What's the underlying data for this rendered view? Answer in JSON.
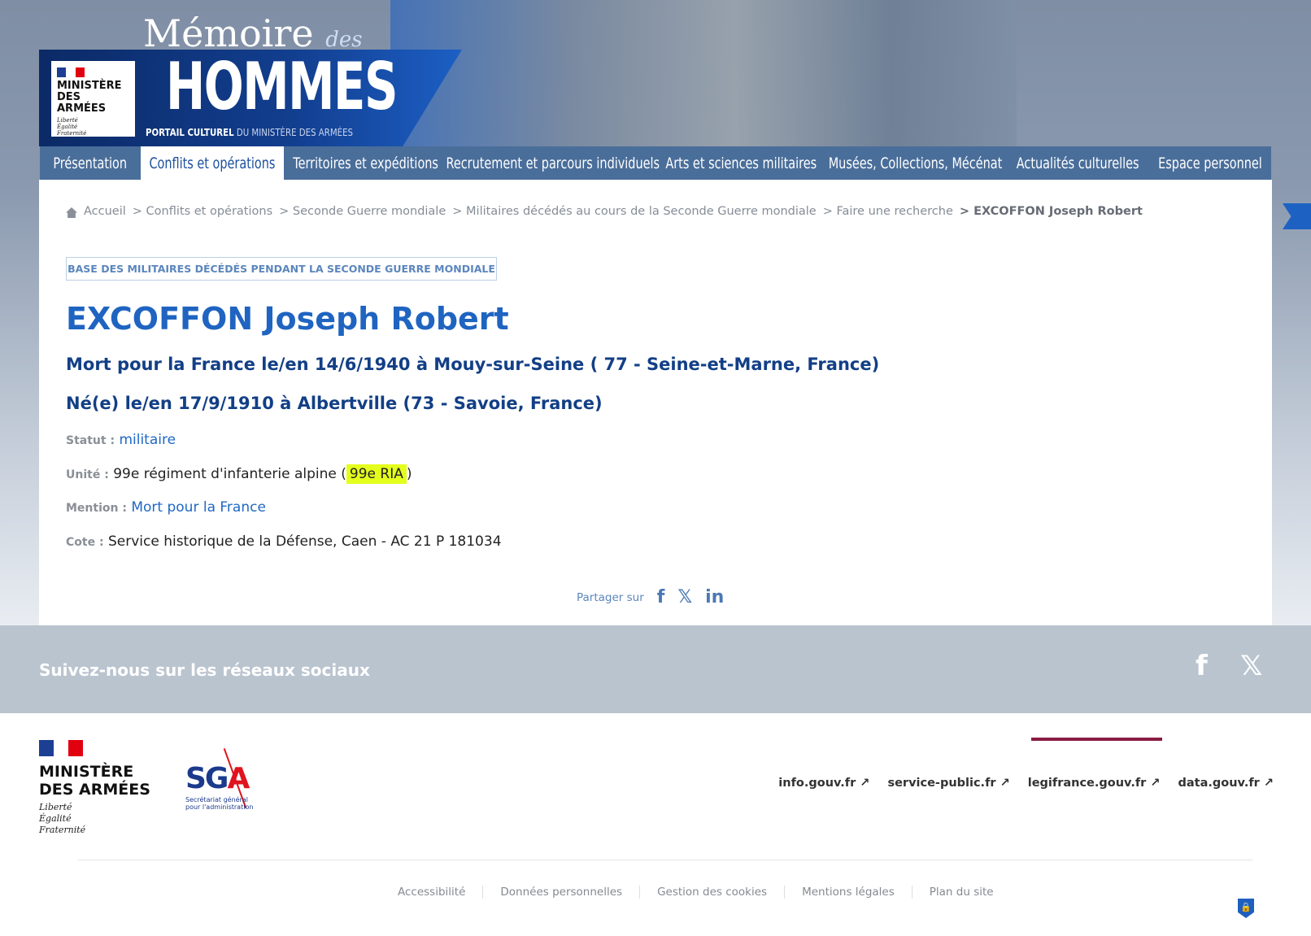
{
  "header": {
    "site_title_1": "Mémoire",
    "site_title_des": "des",
    "site_title_2": "HOMMES",
    "tagline_bold": "PORTAIL CULTUREL",
    "tagline_rest": " DU MINISTÈRE DES ARMÉES",
    "ministry": "MINISTÈRE DES ARMÉES",
    "motto": [
      "Liberté",
      "Égalité",
      "Fraternité"
    ]
  },
  "nav": [
    {
      "label": "Présentation"
    },
    {
      "label": "Conflits et opérations",
      "active": true
    },
    {
      "label": "Territoires et expéditions"
    },
    {
      "label": "Recrutement et parcours individuels"
    },
    {
      "label": "Arts et sciences militaires"
    },
    {
      "label": "Musées, Collections, Mécénat"
    },
    {
      "label": "Actualités culturelles"
    },
    {
      "label": "Espace personnel"
    }
  ],
  "breadcrumb": [
    "Accueil",
    "> Conflits et opérations",
    "> Seconde Guerre mondiale",
    "> Militaires décédés au cours de la Seconde Guerre mondiale",
    "> Faire une recherche",
    "> EXCOFFON Joseph Robert"
  ],
  "record": {
    "badge": "BASE DES MILITAIRES DÉCÉDÉS PENDANT LA SECONDE GUERRE MONDIALE",
    "name": "EXCOFFON Joseph Robert",
    "death": "Mort pour la France le/en 14/6/1940 à Mouy-sur-Seine ( 77 - Seine-et-Marne, France)",
    "birth": "Né(e) le/en 17/9/1910 à Albertville (73 - Savoie, France)",
    "statut_label": "Statut :",
    "statut": "militaire",
    "unite_label": "Unité :",
    "unite": "99e régiment d'infanterie alpine (",
    "unite_abbr": "99e RIA",
    "unite_close": ")",
    "mention_label": "Mention :",
    "mention": "Mort pour la France",
    "cote_label": "Cote :",
    "cote": "Service historique de la Défense, Caen - AC 21 P 181034"
  },
  "share": {
    "label": "Partager sur",
    "facebook": "f",
    "x": "𝕏",
    "linkedin": "in"
  },
  "social": {
    "title": "Suivez-nous sur les réseaux sociaux",
    "facebook": "f",
    "x": "𝕏"
  },
  "footer": {
    "ministry_1": "MINISTÈRE",
    "ministry_2": "DES ARMÉES",
    "motto": [
      "Liberté",
      "Égalité",
      "Fraternité"
    ],
    "sga": "SG",
    "sga_a": "A",
    "sga_sub": "Secrétariat général pour l'administration",
    "external_links": [
      "info.gouv.fr ↗",
      "service-public.fr ↗",
      "legifrance.gouv.fr ↗",
      "data.gouv.fr ↗"
    ],
    "bottom_links": [
      "Accessibilité",
      "Données personnelles",
      "Gestion des cookies",
      "Mentions légales",
      "Plan du site"
    ]
  },
  "colors": {
    "accent": "#1f64c1",
    "dark_blue": "#123f86",
    "highlight": "#e4ff1c",
    "footer_red": "#8a1c43"
  }
}
